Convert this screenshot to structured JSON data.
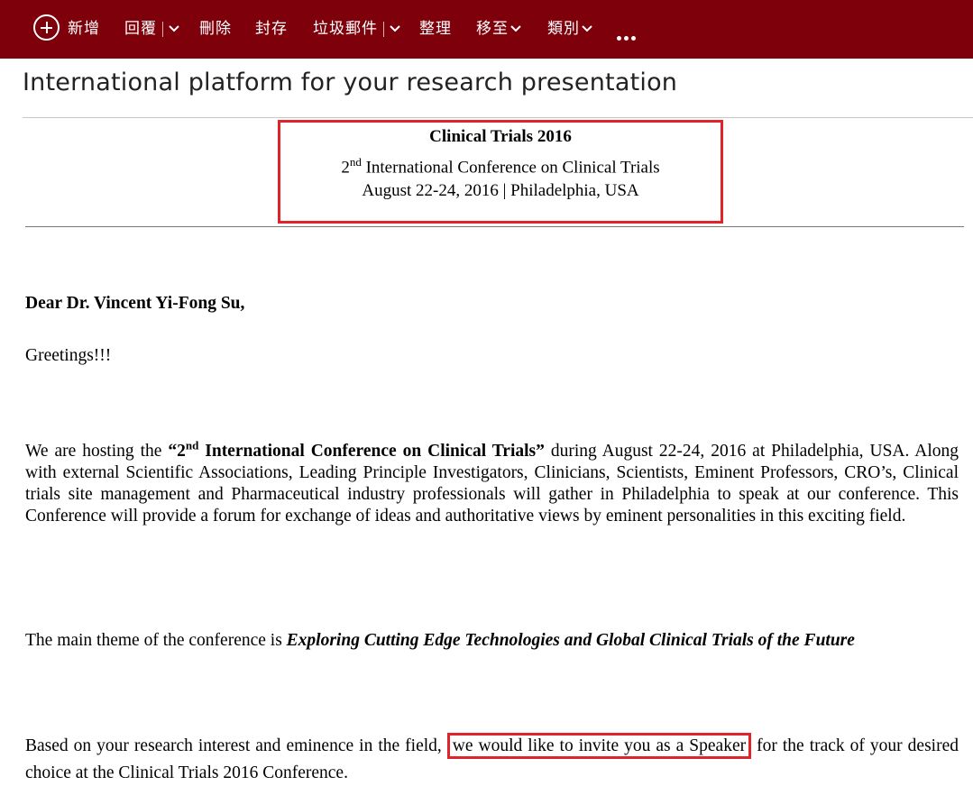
{
  "toolbar": {
    "new_label": "新增",
    "reply_label": "回覆",
    "delete_label": "刪除",
    "archive_label": "封存",
    "junk_label": "垃圾郵件",
    "sweep_label": "整理",
    "move_label": "移至",
    "category_label": "類別"
  },
  "email": {
    "subject": "International platform for your research presentation",
    "header": {
      "title": "Clinical Trials 2016",
      "ordinal_num": "2",
      "ordinal_suffix": "nd",
      "conference_name": " International Conference on Clinical Trials",
      "date_location": "August 22-24, 2016 | Philadelphia, USA"
    },
    "salutation": "Dear Dr. Vincent Yi-Fong Su,",
    "greeting": "Greetings!!!",
    "para1": {
      "before": "We are hosting the ",
      "bold_open": "“2",
      "bold_sup": "nd",
      "bold_rest": " International Conference on Clinical Trials”",
      "after": " during August 22-24, 2016 at Philadelphia, USA. Along with external Scientific Associations, Leading Principle Investigators, Clinicians, Scientists, Eminent Professors, CRO’s, Clinical trials site management and Pharmaceutical industry professionals will gather in Philadelphia to speak at our conference. This Conference will provide a forum for exchange of ideas and authoritative views by eminent personalities in this exciting field."
    },
    "para2": {
      "before": "The main theme of the conference is ",
      "theme": "Exploring Cutting Edge Technologies and Global Clinical Trials of the Future"
    },
    "para3": {
      "before": "Based on your research interest and eminence in the field, ",
      "highlight": "we would like to invite you as a Speaker",
      "after": " for the track of your desired choice at the Clinical Trials 2016 Conference."
    }
  }
}
